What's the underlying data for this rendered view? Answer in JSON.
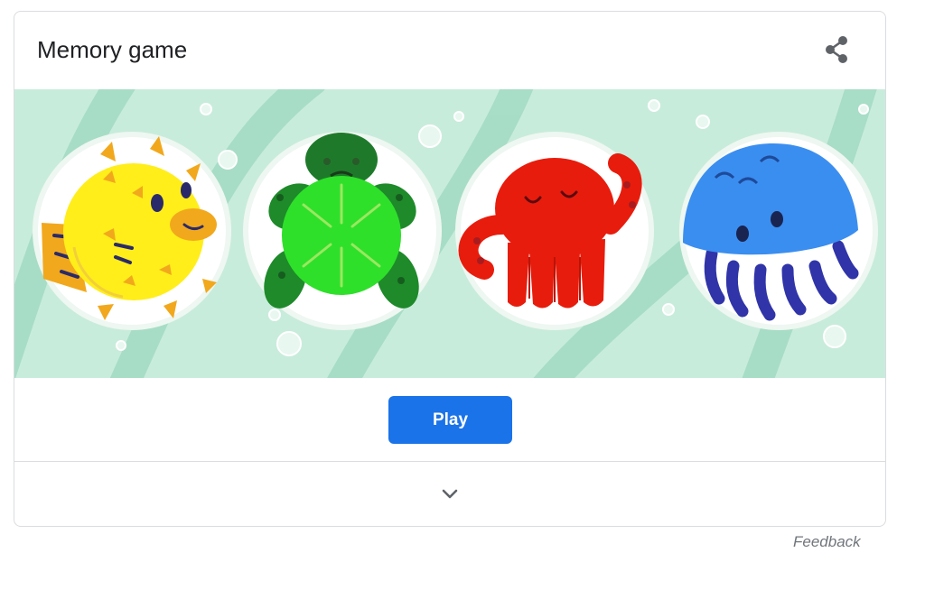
{
  "card": {
    "title": "Memory game",
    "share_icon": "share-icon",
    "banner": {
      "background_color": "#c8ecdc",
      "characters": [
        {
          "name": "pufferfish",
          "color": "#ffee1a"
        },
        {
          "name": "turtle",
          "color": "#2cbe33"
        },
        {
          "name": "octopus",
          "color": "#e81c0c"
        },
        {
          "name": "jellyfish",
          "color": "#3a8ef0"
        }
      ]
    },
    "play_label": "Play",
    "play_color": "#1a73e8",
    "expand_icon": "chevron-down-icon"
  },
  "feedback_label": "Feedback"
}
